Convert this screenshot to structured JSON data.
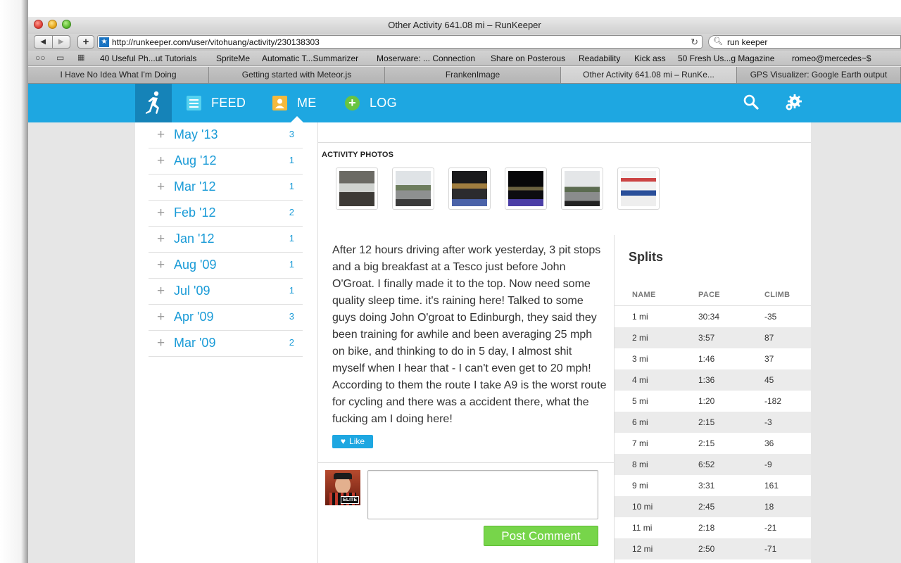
{
  "browser": {
    "window_title": "Other Activity 641.08 mi – RunKeeper",
    "url": "http://runkeeper.com/user/vitohuang/activity/230138303",
    "search_value": "run keeper",
    "bookmarks": [
      "40 Useful Ph...ut Tutorials",
      "SpriteMe",
      "Automatic T...Summarizer",
      "Moserware: ... Connection",
      "Share on Posterous",
      "Readability",
      "Kick ass",
      "50 Fresh Us...g Magazine",
      "romeo@mercedes~$"
    ],
    "tabs": [
      "I Have No Idea What I'm Doing",
      "Getting started with Meteor.js",
      "FrankenImage",
      "Other Activity 641.08 mi – RunKe...",
      "GPS Visualizer: Google Earth output"
    ],
    "active_tab_index": 3
  },
  "nav": {
    "feed": "FEED",
    "me": "ME",
    "log": "LOG",
    "accent_color": "#1ea7e1"
  },
  "months": [
    {
      "label": "May '13",
      "count": "3"
    },
    {
      "label": "Aug '12",
      "count": "1"
    },
    {
      "label": "Mar '12",
      "count": "1"
    },
    {
      "label": "Feb '12",
      "count": "2"
    },
    {
      "label": "Jan '12",
      "count": "1"
    },
    {
      "label": "Aug '09",
      "count": "1"
    },
    {
      "label": "Jul '09",
      "count": "1"
    },
    {
      "label": "Apr '09",
      "count": "3"
    },
    {
      "label": "Mar '09",
      "count": "2"
    }
  ],
  "activity": {
    "photos_label": "ACTIVITY PHOTOS",
    "photo_count": 6,
    "story": "After 12 hours driving after work yesterday, 3 pit stops and a big breakfast at a Tesco just before John O'Groat. I finally made it to the top. Now need some quality sleep time. it's raining here! Talked to some guys doing John O'groat to Edinburgh, they said they been training for awhile and been averaging 25 mph on bike, and thinking to do in 5 day, I almost shit myself when I hear that - I can't even get to 20 mph! According to them the route I take A9 is the worst route for cycling and there was a accident there, what the fucking am I doing here!",
    "like_label": "Like",
    "comment_placeholder": "",
    "post_comment_label": "Post Comment",
    "elite_badge": "ELITE"
  },
  "splits": {
    "title": "Splits",
    "headers": [
      "NAME",
      "PACE",
      "CLIMB"
    ],
    "rows": [
      [
        "1 mi",
        "30:34",
        "-35"
      ],
      [
        "2 mi",
        "3:57",
        "87"
      ],
      [
        "3 mi",
        "1:46",
        "37"
      ],
      [
        "4 mi",
        "1:36",
        "45"
      ],
      [
        "5 mi",
        "1:20",
        "-182"
      ],
      [
        "6 mi",
        "2:15",
        "-3"
      ],
      [
        "7 mi",
        "2:15",
        "36"
      ],
      [
        "8 mi",
        "6:52",
        "-9"
      ],
      [
        "9 mi",
        "3:31",
        "161"
      ],
      [
        "10 mi",
        "2:45",
        "18"
      ],
      [
        "11 mi",
        "2:18",
        "-21"
      ],
      [
        "12 mi",
        "2:50",
        "-71"
      ]
    ]
  }
}
